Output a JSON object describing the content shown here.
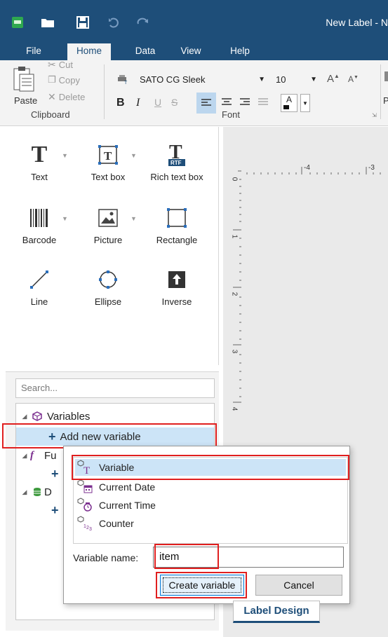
{
  "titlebar": {
    "title": "New Label - N"
  },
  "tabs": [
    "File",
    "Home",
    "Data",
    "View",
    "Help"
  ],
  "ribbon": {
    "clipboard": {
      "paste": "Paste",
      "cut": "Cut",
      "copy": "Copy",
      "delete": "Delete",
      "group_label": "Clipboard"
    },
    "font": {
      "font_name": "SATO CG Sleek",
      "font_size": "10",
      "group_label": "Font",
      "color_letter": "A",
      "bold": "B",
      "italic": "I",
      "underline": "U",
      "strike": "S"
    },
    "partial_label": "P"
  },
  "toolbox": {
    "items": [
      {
        "label": "Text"
      },
      {
        "label": "Text box"
      },
      {
        "label": "Rich text box"
      },
      {
        "label": "Barcode"
      },
      {
        "label": "Picture"
      },
      {
        "label": "Rectangle"
      },
      {
        "label": "Line"
      },
      {
        "label": "Ellipse"
      },
      {
        "label": "Inverse"
      }
    ],
    "rtf_tag": "RTF"
  },
  "ruler": {
    "top_ticks": [
      "-4",
      "-3"
    ],
    "left_ticks": [
      "0",
      "1",
      "2",
      "3",
      "4"
    ]
  },
  "datasources": {
    "search_placeholder": "Search...",
    "variables_label": "Variables",
    "add_variable_label": "Add new variable",
    "functions_label_partial": "Fu",
    "databases_label_partial": "D"
  },
  "popup": {
    "items": [
      {
        "label": "Variable",
        "icon": "variable-icon"
      },
      {
        "label": "Current Date",
        "icon": "current-date-icon"
      },
      {
        "label": "Current Time",
        "icon": "current-time-icon"
      },
      {
        "label": "Counter",
        "icon": "counter-icon"
      }
    ],
    "name_label": "Variable name:",
    "name_value": "item",
    "create_button": "Create variable",
    "cancel_button": "Cancel"
  },
  "bottom_tab": "Label Design",
  "colors": {
    "accent": "#1e4e79",
    "highlight": "#e01f1f",
    "selection": "#cce4f7"
  }
}
